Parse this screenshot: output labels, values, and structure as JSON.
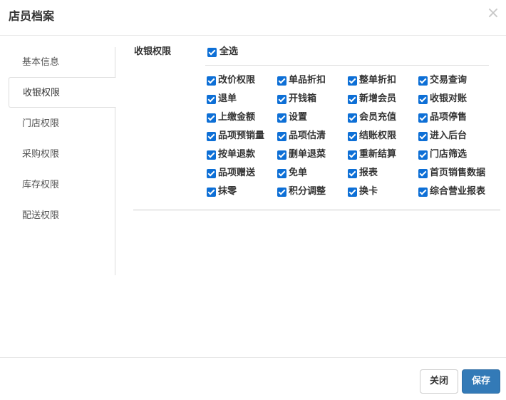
{
  "header": {
    "title": "店员档案",
    "close_icon": "×"
  },
  "sidebar": {
    "items": [
      {
        "label": "基本信息",
        "active": false
      },
      {
        "label": "收银权限",
        "active": true
      },
      {
        "label": "门店权限",
        "active": false
      },
      {
        "label": "采购权限",
        "active": false
      },
      {
        "label": "库存权限",
        "active": false
      },
      {
        "label": "配送权限",
        "active": false
      }
    ]
  },
  "section": {
    "label": "收银权限",
    "select_all": {
      "label": "全选",
      "checked": true
    },
    "options": [
      [
        "改价权限",
        "单品折扣",
        "整单折扣",
        "交易查询"
      ],
      [
        "退单",
        "开钱箱",
        "新增会员",
        "收银对账"
      ],
      [
        "上缴金额",
        "设置",
        "会员充值",
        "品项停售"
      ],
      [
        "品项预销量",
        "品项估清",
        "结账权限",
        "进入后台"
      ],
      [
        "按单退款",
        "删单退菜",
        "重新结算",
        "门店筛选"
      ],
      [
        "品项赠送",
        "免单",
        "报表",
        "首页销售数据"
      ],
      [
        "抹零",
        "积分调整",
        "换卡",
        "综合营业报表"
      ]
    ]
  },
  "footer": {
    "close_label": "关闭",
    "save_label": "保存"
  },
  "colors": {
    "checkbox": "#0d6fd6",
    "primary": "#337ab7",
    "border": "#dddddd"
  }
}
